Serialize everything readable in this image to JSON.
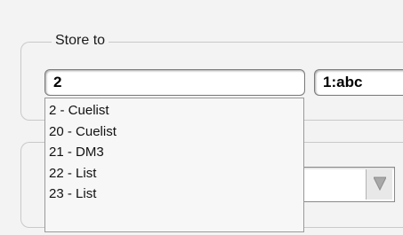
{
  "store_group": {
    "legend": "Store to"
  },
  "store_field": {
    "value": "2"
  },
  "name_field": {
    "value": "1:abc"
  },
  "dropdown": {
    "options": [
      "2 - Cuelist",
      "20 - Cuelist",
      "21 - DM3",
      "22 - List",
      "23 - List"
    ]
  },
  "icons": {
    "select_arrow": "chevron-down-icon"
  }
}
